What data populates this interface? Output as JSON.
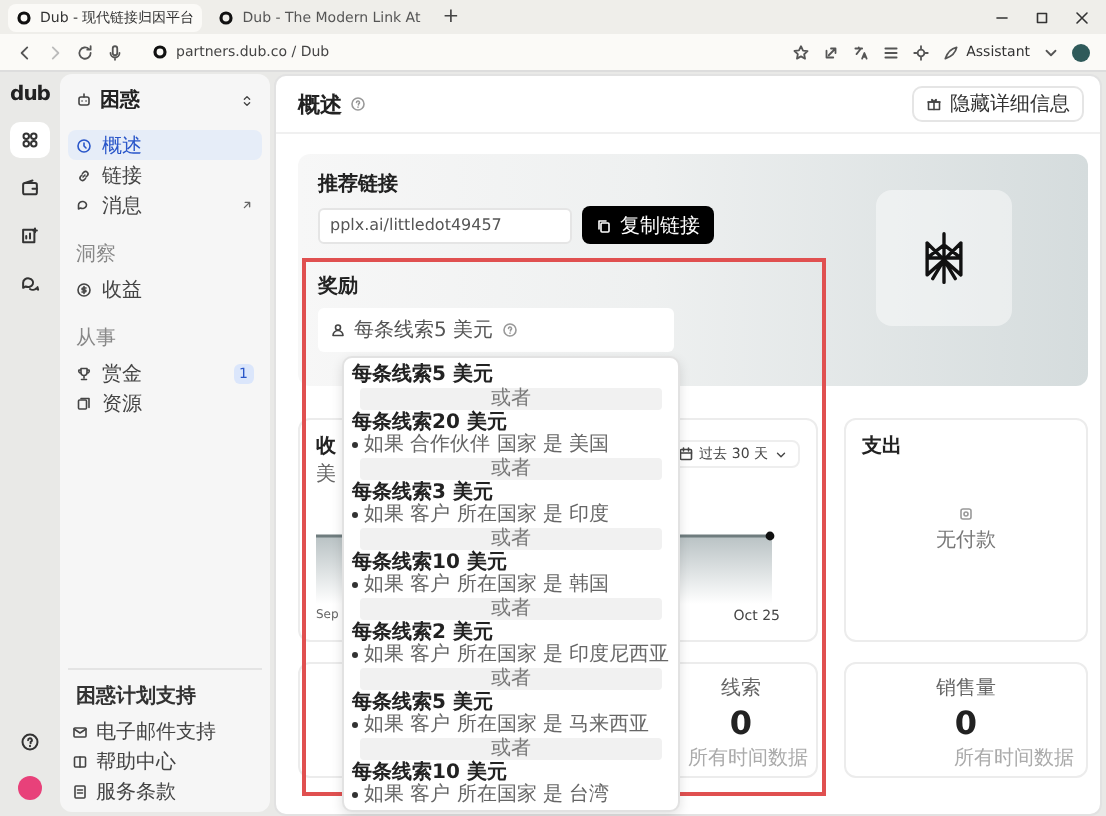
{
  "browser": {
    "tabs": [
      {
        "title": "Dub - 现代链接归因平台",
        "selected": true
      },
      {
        "title": "Dub - The Modern Link At",
        "selected": false
      }
    ],
    "new_tab": "+",
    "address": "partners.dub.co / Dub",
    "assistant": "Assistant"
  },
  "rail": {
    "logo": "dub",
    "items": [
      {
        "selected": true
      },
      {
        "selected": false
      },
      {
        "selected": false
      },
      {
        "selected": false
      }
    ]
  },
  "sidebar": {
    "workspace": "困惑",
    "items": [
      {
        "kind": "item",
        "label": "概述",
        "selected": true,
        "external": false
      },
      {
        "kind": "item",
        "label": "链接",
        "selected": false,
        "external": false
      },
      {
        "kind": "item",
        "label": "消息",
        "selected": false,
        "external": true
      },
      {
        "kind": "heading",
        "label": "洞察"
      },
      {
        "kind": "item",
        "label": "收益",
        "selected": false,
        "external": false
      },
      {
        "kind": "heading",
        "label": "从事"
      },
      {
        "kind": "item",
        "label": "赏金",
        "selected": false,
        "external": false,
        "badge": "1"
      },
      {
        "kind": "item",
        "label": "资源",
        "selected": false,
        "external": false
      }
    ],
    "support": {
      "title": "困惑计划支持",
      "links": [
        "电子邮件支持",
        "帮助中心",
        "服务条款"
      ]
    }
  },
  "main": {
    "title": "概述",
    "hide_button": "隐藏详细信息",
    "referral": {
      "title": "推荐链接",
      "link": "pplx.ai/littledot49457",
      "copy_button": "复制链接"
    },
    "rewards": {
      "title": "奖励",
      "summary": "每条线索5 美元",
      "popup": [
        {
          "kind": "reward",
          "title": "每条线索5 美元"
        },
        {
          "kind": "separator",
          "text": "或者"
        },
        {
          "kind": "reward",
          "title": "每条线索20 美元",
          "condition": "如果 合作伙伴 国家 是 美国"
        },
        {
          "kind": "separator",
          "text": "或者"
        },
        {
          "kind": "reward",
          "title": "每条线索3 美元",
          "condition": "如果 客户 所在国家 是 印度"
        },
        {
          "kind": "separator",
          "text": "或者"
        },
        {
          "kind": "reward",
          "title": "每条线索10 美元",
          "condition": "如果 客户 所在国家 是 韩国"
        },
        {
          "kind": "separator",
          "text": "或者"
        },
        {
          "kind": "reward",
          "title": "每条线索2 美元",
          "condition": "如果 客户 所在国家 是 印度尼西亚"
        },
        {
          "kind": "separator",
          "text": "或者"
        },
        {
          "kind": "reward",
          "title": "每条线索5 美元",
          "condition": "如果 客户 所在国家 是 马来西亚"
        },
        {
          "kind": "separator",
          "text": "或者"
        },
        {
          "kind": "reward",
          "title": "每条线索10 美元",
          "condition": "如果 客户 所在国家 是 台湾"
        }
      ]
    },
    "earnings": {
      "title": "收",
      "subtitle": "美",
      "range": "过去 30 天",
      "x_start": "Sep",
      "x_end": "Oct 25"
    },
    "payouts": {
      "title": "支出",
      "empty": "无付款"
    },
    "stats": [
      {
        "label": "线索",
        "value": "0",
        "note": "所有时间数据"
      },
      {
        "label": "销售量",
        "value": "0",
        "note": "所有时间数据"
      }
    ]
  }
}
